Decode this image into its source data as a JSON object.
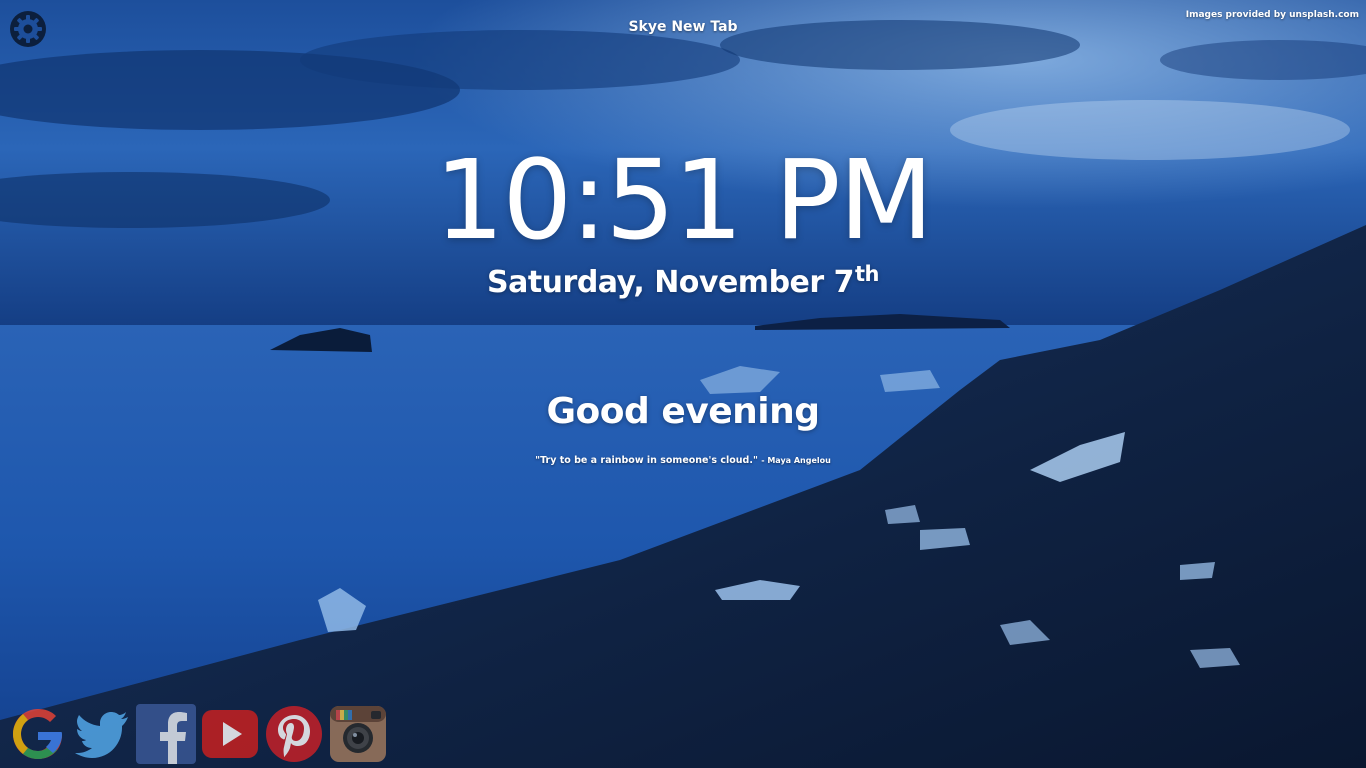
{
  "app": {
    "title": "Skye New Tab",
    "credit": "Images provided by unsplash.com"
  },
  "clock": {
    "time": "10:51 PM",
    "date_main": "Saturday, November 7",
    "date_suffix": "th"
  },
  "greeting": "Good evening",
  "quote": {
    "text": "\"Try to be a rainbow in someone's cloud.\"",
    "author": "- Maya Angelou"
  },
  "icons": {
    "settings": "gear-icon",
    "links": [
      "google-icon",
      "twitter-icon",
      "facebook-icon",
      "youtube-icon",
      "pinterest-icon",
      "instagram-icon"
    ]
  },
  "colors": {
    "sky": "#1a4f9e",
    "water": "#1e56b0",
    "shore": "#0c1a33",
    "text": "#ffffff"
  }
}
